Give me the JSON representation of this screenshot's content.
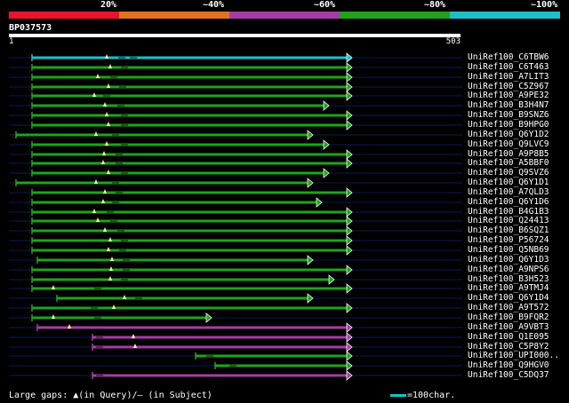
{
  "legend": {
    "labels": [
      "20%",
      "~40%",
      "~60%",
      "~80%",
      "~100%"
    ],
    "colors": [
      "#e8152c",
      "#e5721c",
      "#a73ca7",
      "#1fa31c",
      "#1fbfc8"
    ]
  },
  "query": {
    "id": "BP037573",
    "start": "1",
    "end": "503"
  },
  "hits": [
    {
      "name": "UniRef100_C6TBW6",
      "color": "#1fbfc8",
      "start": 36,
      "end": 396,
      "segments": [],
      "gaps": [
        {
          "at": 120,
          "type": "query"
        },
        {
          "at": 137,
          "type": "subject"
        },
        {
          "at": 150,
          "type": "subject"
        }
      ]
    },
    {
      "name": "UniRef100_C6T463",
      "color": "#1fa31c",
      "start": 36,
      "end": 396,
      "segments": [],
      "gaps": [
        {
          "at": 124,
          "type": "query"
        },
        {
          "at": 140,
          "type": "subject"
        }
      ]
    },
    {
      "name": "UniRef100_A7LIT3",
      "color": "#1fa31c",
      "start": 36,
      "end": 396,
      "segments": [],
      "gaps": [
        {
          "at": 110,
          "type": "query"
        },
        {
          "at": 128,
          "type": "subject"
        }
      ]
    },
    {
      "name": "UniRef100_C5Z967",
      "color": "#1fa31c",
      "start": 36,
      "end": 396,
      "segments": [],
      "gaps": [
        {
          "at": 122,
          "type": "query"
        },
        {
          "at": 138,
          "type": "subject"
        }
      ]
    },
    {
      "name": "UniRef100_A9PE32",
      "color": "#1fa31c",
      "start": 36,
      "end": 396,
      "segments": [],
      "gaps": [
        {
          "at": 106,
          "type": "query"
        },
        {
          "at": 120,
          "type": "subject"
        }
      ]
    },
    {
      "name": "UniRef100_B3H4N7",
      "color": "#1fa31c",
      "start": 36,
      "end": 370,
      "segments": [],
      "gaps": [
        {
          "at": 118,
          "type": "query"
        },
        {
          "at": 136,
          "type": "subject"
        }
      ]
    },
    {
      "name": "UniRef100_B9SNZ6",
      "color": "#1fa31c",
      "start": 36,
      "end": 396,
      "segments": [],
      "gaps": [
        {
          "at": 120,
          "type": "query"
        },
        {
          "at": 140,
          "type": "subject"
        }
      ]
    },
    {
      "name": "UniRef100_B9HPG0",
      "color": "#1fa31c",
      "start": 36,
      "end": 396,
      "segments": [],
      "gaps": [
        {
          "at": 122,
          "type": "query"
        },
        {
          "at": 140,
          "type": "subject"
        }
      ]
    },
    {
      "name": "UniRef100_Q6Y1D2",
      "color": "#1fa31c",
      "start": 18,
      "end": 352,
      "segments": [],
      "gaps": [
        {
          "at": 108,
          "type": "query"
        },
        {
          "at": 130,
          "type": "subject"
        }
      ]
    },
    {
      "name": "UniRef100_Q9LVC9",
      "color": "#1fa31c",
      "start": 36,
      "end": 370,
      "segments": [],
      "gaps": [
        {
          "at": 120,
          "type": "query"
        },
        {
          "at": 140,
          "type": "subject"
        }
      ]
    },
    {
      "name": "UniRef100_A9P8B5",
      "color": "#1fa31c",
      "start": 36,
      "end": 396,
      "segments": [],
      "gaps": [
        {
          "at": 117,
          "type": "query"
        },
        {
          "at": 134,
          "type": "subject"
        }
      ]
    },
    {
      "name": "UniRef100_A5BBF0",
      "color": "#1fa31c",
      "start": 36,
      "end": 396,
      "segments": [],
      "gaps": [
        {
          "at": 116,
          "type": "query"
        },
        {
          "at": 134,
          "type": "subject"
        }
      ]
    },
    {
      "name": "UniRef100_Q9SVZ6",
      "color": "#1fa31c",
      "start": 36,
      "end": 370,
      "segments": [],
      "gaps": [
        {
          "at": 122,
          "type": "query"
        },
        {
          "at": 140,
          "type": "subject"
        }
      ]
    },
    {
      "name": "UniRef100_Q6Y1D1",
      "color": "#1fa31c",
      "start": 18,
      "end": 352,
      "segments": [],
      "gaps": [
        {
          "at": 108,
          "type": "query"
        },
        {
          "at": 130,
          "type": "subject"
        }
      ]
    },
    {
      "name": "UniRef100_A7QLD3",
      "color": "#1fa31c",
      "start": 36,
      "end": 396,
      "segments": [],
      "gaps": [
        {
          "at": 118,
          "type": "query"
        },
        {
          "at": 134,
          "type": "subject"
        }
      ]
    },
    {
      "name": "UniRef100_Q6Y1D6",
      "color": "#1fa31c",
      "start": 36,
      "end": 362,
      "segments": [],
      "gaps": [
        {
          "at": 116,
          "type": "query"
        },
        {
          "at": 130,
          "type": "subject"
        }
      ]
    },
    {
      "name": "UniRef100_B4G1B3",
      "color": "#1fa31c",
      "start": 36,
      "end": 396,
      "segments": [],
      "gaps": [
        {
          "at": 106,
          "type": "query"
        },
        {
          "at": 124,
          "type": "subject"
        }
      ]
    },
    {
      "name": "UniRef100_Q24413",
      "color": "#1fa31c",
      "start": 36,
      "end": 396,
      "segments": [],
      "gaps": [
        {
          "at": 110,
          "type": "query"
        },
        {
          "at": 128,
          "type": "subject"
        }
      ]
    },
    {
      "name": "UniRef100_B6SQZ1",
      "color": "#1fa31c",
      "start": 36,
      "end": 396,
      "segments": [],
      "gaps": [
        {
          "at": 118,
          "type": "query"
        },
        {
          "at": 136,
          "type": "subject"
        }
      ]
    },
    {
      "name": "UniRef100_P56724",
      "color": "#1fa31c",
      "start": 36,
      "end": 396,
      "segments": [],
      "gaps": [
        {
          "at": 124,
          "type": "query"
        },
        {
          "at": 140,
          "type": "subject"
        }
      ]
    },
    {
      "name": "UniRef100_Q5NB69",
      "color": "#1fa31c",
      "start": 36,
      "end": 396,
      "segments": [],
      "gaps": [
        {
          "at": 122,
          "type": "query"
        },
        {
          "at": 138,
          "type": "subject"
        }
      ]
    },
    {
      "name": "UniRef100_Q6Y1D3",
      "color": "#1fa31c",
      "start": 42,
      "end": 352,
      "segments": [],
      "gaps": [
        {
          "at": 126,
          "type": "query"
        },
        {
          "at": 142,
          "type": "subject"
        }
      ]
    },
    {
      "name": "UniRef100_A9NPS6",
      "color": "#1fa31c",
      "start": 36,
      "end": 396,
      "segments": [],
      "gaps": [
        {
          "at": 125,
          "type": "query"
        },
        {
          "at": 142,
          "type": "subject"
        }
      ]
    },
    {
      "name": "UniRef100_B3H523",
      "color": "#1fa31c",
      "start": 36,
      "end": 376,
      "segments": [],
      "gaps": [
        {
          "at": 124,
          "type": "query"
        },
        {
          "at": 140,
          "type": "subject"
        }
      ]
    },
    {
      "name": "UniRef100_A9TMJ4",
      "color": "#1fa31c",
      "start": 36,
      "end": 396,
      "segments": [],
      "gaps": [
        {
          "at": 60,
          "type": "query"
        },
        {
          "at": 110,
          "type": "subject"
        }
      ]
    },
    {
      "name": "UniRef100_Q6Y1D4",
      "color": "#1fa31c",
      "start": 64,
      "end": 352,
      "segments": [],
      "gaps": [
        {
          "at": 140,
          "type": "query"
        },
        {
          "at": 156,
          "type": "subject"
        }
      ]
    },
    {
      "name": "UniRef100_A9T572",
      "color": "#1fa31c",
      "start": 36,
      "end": 396,
      "segments": [],
      "gaps": [
        {
          "at": 128,
          "type": "query"
        },
        {
          "at": 106,
          "type": "subject"
        }
      ]
    },
    {
      "name": "UniRef100_B9FQR2",
      "color": "#1fa31c",
      "start": 36,
      "end": 238,
      "segments": [],
      "gaps": [
        {
          "at": 60,
          "type": "query"
        },
        {
          "at": 110,
          "type": "subject"
        }
      ]
    },
    {
      "name": "UniRef100_A9VBT3",
      "color": "#a73ca7",
      "start": 42,
      "end": 396,
      "segments": [],
      "gaps": [
        {
          "at": 78,
          "type": "query"
        }
      ]
    },
    {
      "name": "UniRef100_Q1E095",
      "color": "#a73ca7",
      "start": 104,
      "end": 396,
      "segments": [],
      "gaps": [
        {
          "at": 150,
          "type": "query"
        },
        {
          "at": 112,
          "type": "subject"
        }
      ]
    },
    {
      "name": "UniRef100_C5P8Y2",
      "color": "#a73ca7",
      "start": 104,
      "end": 396,
      "segments": [],
      "gaps": [
        {
          "at": 152,
          "type": "query"
        },
        {
          "at": 112,
          "type": "subject"
        }
      ]
    },
    {
      "name": "UniRef100_UPI000..",
      "color": "#1fa31c",
      "start": 220,
      "end": 396,
      "segments": [],
      "gaps": [
        {
          "at": 236,
          "type": "subject"
        }
      ]
    },
    {
      "name": "UniRef100_Q9HGV0",
      "color": "#1fa31c",
      "start": 242,
      "end": 396,
      "segments": [],
      "gaps": [
        {
          "at": 262,
          "type": "subject"
        }
      ]
    },
    {
      "name": "UniRef100_C5DQ37",
      "color": "#a73ca7",
      "start": 104,
      "end": 396,
      "segments": [],
      "gaps": [
        {
          "at": 112,
          "type": "subject"
        }
      ]
    }
  ],
  "footer": {
    "gaps_label": "Large gaps: ▲(in Query)/— (in Subject)",
    "scale_label": "=100char."
  }
}
